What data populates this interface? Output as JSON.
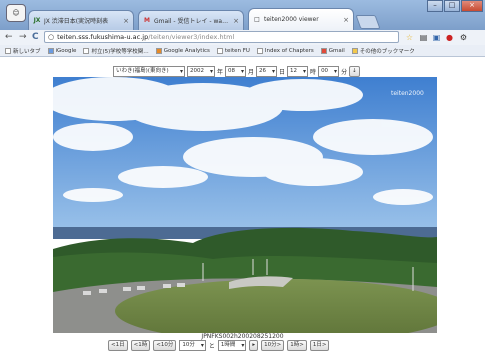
{
  "window": {
    "buttons": [
      "–",
      "□",
      "×"
    ]
  },
  "tabs": [
    {
      "icon": "JX",
      "title": "JX 渋滞日本(実況時刻表",
      "active": false
    },
    {
      "icon": "M",
      "title": "Gmail - 受信トレイ - watan.",
      "active": false
    },
    {
      "icon": "□",
      "title": "teiten2000 viewer",
      "active": true
    }
  ],
  "toolbar": {
    "back": "←",
    "forward": "→",
    "reload": "C",
    "url_host": "teiten.sss.fukushima-u.ac.jp",
    "url_path": "/teiten/viewer3/index.html"
  },
  "bookmarks": [
    {
      "label": "新しいタブ"
    },
    {
      "label": "iGoogle"
    },
    {
      "label": "村立(5)学校等学校関…"
    },
    {
      "label": "Google Analytics"
    },
    {
      "label": "teiten FU"
    },
    {
      "label": "Index of Chapters"
    },
    {
      "label": "Gmail"
    },
    {
      "label": "その他のブックマーク"
    }
  ],
  "viewer": {
    "location": "いわき(福島)(東向き)",
    "year": "2002",
    "year_unit": "年",
    "month": "08",
    "month_unit": "月",
    "day": "26",
    "day_unit": "日",
    "hour": "12",
    "hour_unit": "時",
    "minute": "00",
    "minute_unit": "分",
    "go": "↓",
    "watermark": "teiten2000",
    "filename": "JPNFKS002h200208251200",
    "nav": {
      "b1": "<1日",
      "b2": "<1時",
      "b3": "<10分",
      "interval_a": "10分",
      "to": "と",
      "interval_b": "1時間",
      "b4": "▸",
      "b5": "10分>",
      "b6": "1時>",
      "b7": "1日>"
    }
  }
}
